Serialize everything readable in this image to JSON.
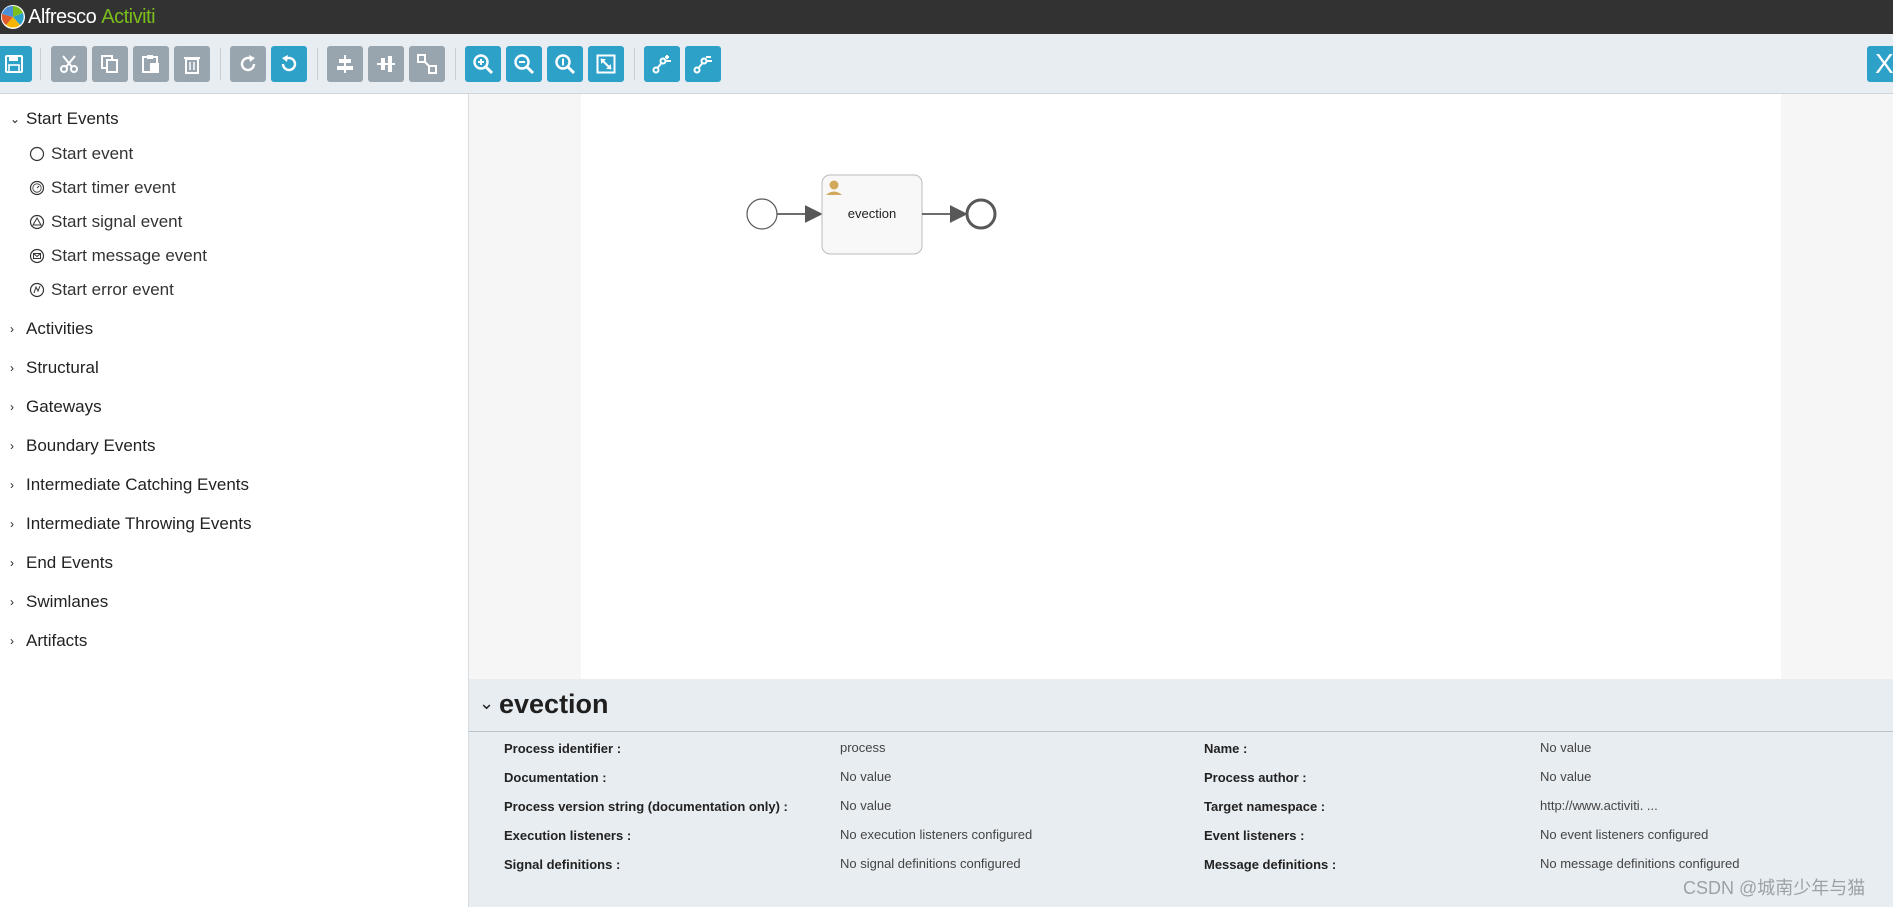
{
  "app": {
    "title_part1": "Alfresco",
    "title_part2": "Activiti"
  },
  "toolbar": {
    "buttons": [
      {
        "name": "save-icon",
        "style": "teal"
      },
      {
        "name": "cut-icon",
        "style": "gray"
      },
      {
        "name": "copy-icon",
        "style": "gray"
      },
      {
        "name": "paste-icon",
        "style": "gray"
      },
      {
        "name": "delete-icon",
        "style": "gray"
      },
      {
        "name": "redo-icon",
        "style": "gray"
      },
      {
        "name": "undo-icon",
        "style": "teal"
      },
      {
        "name": "align-horizontal-icon",
        "style": "gray"
      },
      {
        "name": "align-vertical-icon",
        "style": "gray"
      },
      {
        "name": "same-size-icon",
        "style": "gray"
      },
      {
        "name": "zoom-in-icon",
        "style": "teal"
      },
      {
        "name": "zoom-out-icon",
        "style": "teal"
      },
      {
        "name": "zoom-actual-icon",
        "style": "teal"
      },
      {
        "name": "zoom-fit-icon",
        "style": "teal"
      },
      {
        "name": "add-bendpoint-icon",
        "style": "teal"
      },
      {
        "name": "remove-bendpoint-icon",
        "style": "teal"
      }
    ],
    "close_label": "X"
  },
  "palette": {
    "groups": [
      {
        "label": "Start Events",
        "expanded": true,
        "items": [
          {
            "label": "Start event",
            "icon": "circle-icon"
          },
          {
            "label": "Start timer event",
            "icon": "timer-icon"
          },
          {
            "label": "Start signal event",
            "icon": "signal-icon"
          },
          {
            "label": "Start message event",
            "icon": "message-icon"
          },
          {
            "label": "Start error event",
            "icon": "error-icon"
          }
        ]
      },
      {
        "label": "Activities",
        "expanded": false
      },
      {
        "label": "Structural",
        "expanded": false
      },
      {
        "label": "Gateways",
        "expanded": false
      },
      {
        "label": "Boundary Events",
        "expanded": false
      },
      {
        "label": "Intermediate Catching Events",
        "expanded": false
      },
      {
        "label": "Intermediate Throwing Events",
        "expanded": false
      },
      {
        "label": "End Events",
        "expanded": false
      },
      {
        "label": "Swimlanes",
        "expanded": false
      },
      {
        "label": "Artifacts",
        "expanded": false
      }
    ]
  },
  "diagram": {
    "task_label": "evection"
  },
  "properties": {
    "title": "evection",
    "left": [
      {
        "label": "Process identifier :",
        "value": "process"
      },
      {
        "label": "Documentation :",
        "value": "No value"
      },
      {
        "label": "Process version string (documentation only) :",
        "value": "No value"
      },
      {
        "label": "Execution listeners :",
        "value": "No execution listeners configured"
      },
      {
        "label": "Signal definitions :",
        "value": "No signal definitions configured"
      }
    ],
    "right": [
      {
        "label": "Name :",
        "value": "No value"
      },
      {
        "label": "Process author :",
        "value": "No value"
      },
      {
        "label": "Target namespace :",
        "value": "http://www.activiti. ..."
      },
      {
        "label": "Event listeners :",
        "value": "No event listeners configured"
      },
      {
        "label": "Message definitions :",
        "value": "No message definitions configured"
      }
    ]
  },
  "watermark": "CSDN @城南少年与猫",
  "colors": {
    "accent": "#2ea1c9",
    "gray_button": "#98a5ae",
    "topbar": "#323232",
    "brand_green": "#7bbe1c"
  }
}
